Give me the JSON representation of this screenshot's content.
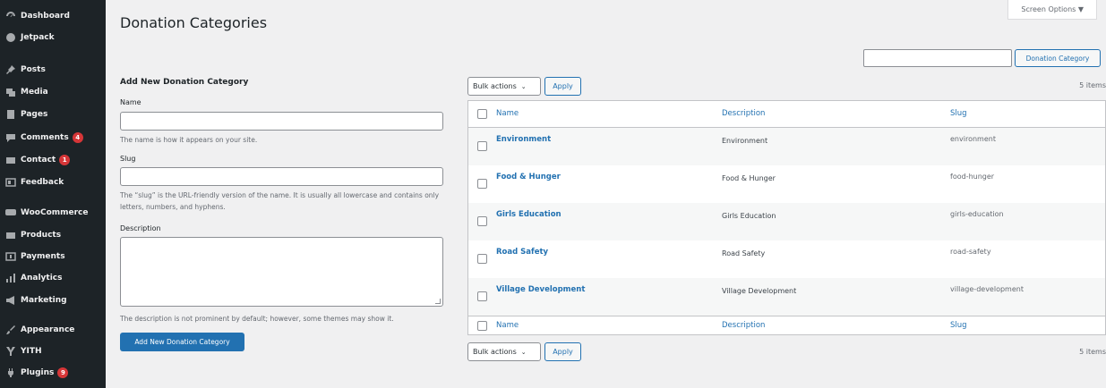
{
  "sidebar": {
    "items": [
      {
        "label": "Dashboard",
        "icon": "dashboard-icon"
      },
      {
        "label": "Jetpack",
        "icon": "jetpack-icon"
      },
      {
        "label": "Posts",
        "icon": "pin-icon"
      },
      {
        "label": "Media",
        "icon": "media-icon"
      },
      {
        "label": "Pages",
        "icon": "pages-icon"
      },
      {
        "label": "Comments",
        "icon": "comments-icon",
        "badge": "4"
      },
      {
        "label": "Contact",
        "icon": "mail-icon",
        "badge": "1"
      },
      {
        "label": "Feedback",
        "icon": "feedback-icon"
      },
      {
        "label": "WooCommerce",
        "icon": "woocommerce-icon"
      },
      {
        "label": "Products",
        "icon": "products-icon"
      },
      {
        "label": "Payments",
        "icon": "payments-icon"
      },
      {
        "label": "Analytics",
        "icon": "analytics-icon"
      },
      {
        "label": "Marketing",
        "icon": "megaphone-icon"
      },
      {
        "label": "Appearance",
        "icon": "brush-icon"
      },
      {
        "label": "YITH",
        "icon": "yith-icon"
      },
      {
        "label": "Plugins",
        "icon": "plugin-icon",
        "badge": "9"
      }
    ]
  },
  "header": {
    "title": "Donation Categories",
    "screen_options": "Screen Options ▼"
  },
  "search": {
    "value": "",
    "button": "Donation Category"
  },
  "form": {
    "heading": "Add New Donation Category",
    "name_label": "Name",
    "name_value": "",
    "name_hint": "The name is how it appears on your site.",
    "slug_label": "Slug",
    "slug_value": "",
    "slug_hint": "The “slug” is the URL-friendly version of the name. It is usually all lowercase and contains only letters, numbers, and hyphens.",
    "description_label": "Description",
    "description_value": "",
    "description_hint": "The description is not prominent by default; however, some themes may show it.",
    "submit": "Add New Donation Category"
  },
  "table": {
    "bulk_label": "Bulk actions",
    "apply_label": "Apply",
    "items_count": "5 items",
    "columns": {
      "name": "Name",
      "description": "Description",
      "slug": "Slug"
    },
    "rows": [
      {
        "name": "Environment",
        "description": "Environment",
        "slug": "environment"
      },
      {
        "name": "Food & Hunger",
        "description": "Food & Hunger",
        "slug": "food-hunger"
      },
      {
        "name": "Girls Education",
        "description": "Girls Education",
        "slug": "girls-education"
      },
      {
        "name": "Road Safety",
        "description": "Road Safety",
        "slug": "road-safety"
      },
      {
        "name": "Village Development",
        "description": "Village Development",
        "slug": "village-development"
      }
    ]
  }
}
